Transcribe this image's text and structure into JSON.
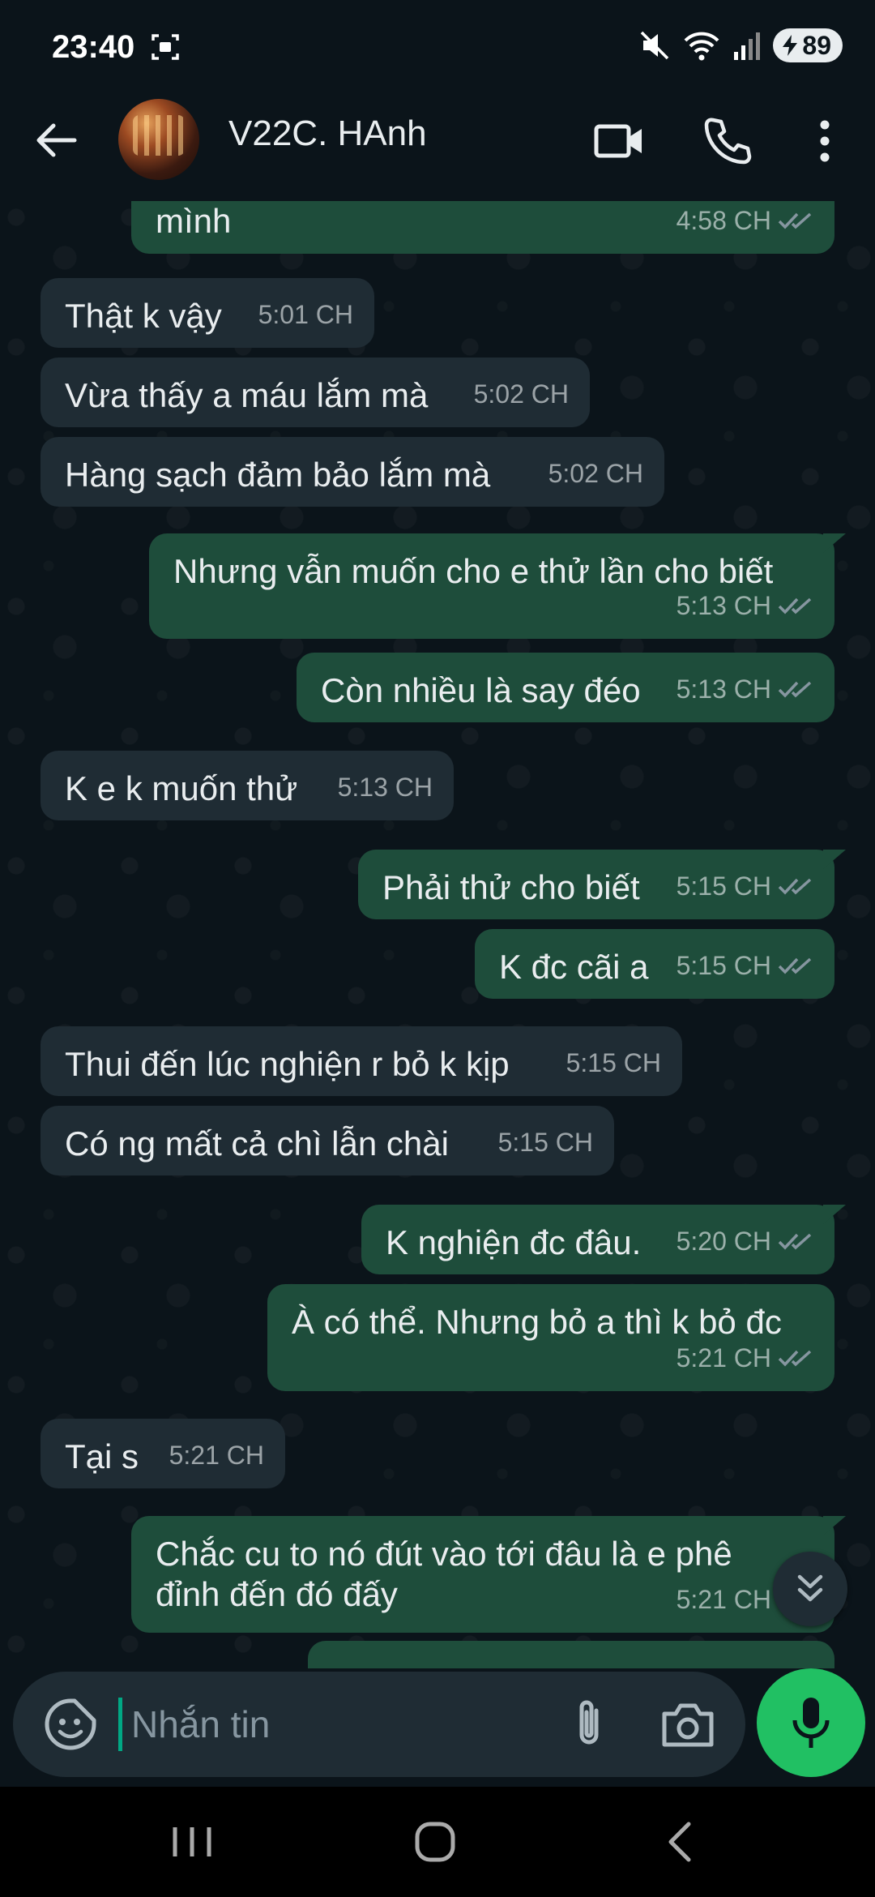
{
  "status_bar": {
    "time": "23:40",
    "battery": "89"
  },
  "header": {
    "contact_name": "V22C. HAnh"
  },
  "messages": [
    {
      "dir": "out",
      "text": "mình",
      "time": "4:58 CH",
      "read": true
    },
    {
      "dir": "in",
      "text": "Thật k vậy",
      "time": "5:01 CH"
    },
    {
      "dir": "in",
      "text": "Vừa thấy a máu lắm mà",
      "time": "5:02 CH"
    },
    {
      "dir": "in",
      "text": "Hàng sạch đảm bảo lắm mà",
      "time": "5:02 CH"
    },
    {
      "dir": "out",
      "text": "Nhưng vẫn muốn cho e thử lần cho biết",
      "time": "5:13 CH",
      "read": true
    },
    {
      "dir": "out",
      "text": "Còn nhiều là say đéo",
      "time": "5:13 CH",
      "read": true
    },
    {
      "dir": "in",
      "text": "K e k muốn thử",
      "time": "5:13 CH"
    },
    {
      "dir": "out",
      "text": "Phải thử cho biết",
      "time": "5:15 CH",
      "read": true
    },
    {
      "dir": "out",
      "text": "K đc cãi a",
      "time": "5:15 CH",
      "read": true
    },
    {
      "dir": "in",
      "text": "Thui đến lúc nghiện r bỏ k kịp",
      "time": "5:15 CH"
    },
    {
      "dir": "in",
      "text": "Có ng mất cả chì lẫn chài",
      "time": "5:15 CH"
    },
    {
      "dir": "out",
      "text": "K nghiện đc đâu.",
      "time": "5:20 CH",
      "read": true
    },
    {
      "dir": "out",
      "text": "À có thể. Nhưng bỏ a thì k bỏ đc",
      "time": "5:21 CH",
      "read": true
    },
    {
      "dir": "in",
      "text": "Tại s",
      "time": "5:21 CH"
    },
    {
      "dir": "out",
      "text": "Chắc cu to nó đút vào tới đâu là e phê đỉnh đến đó đấy",
      "time": "5:21 CH",
      "read": true
    }
  ],
  "input": {
    "placeholder": "Nhắn tin"
  },
  "colors": {
    "outgoing": "#1e4d3b",
    "incoming": "#1f2c34",
    "accent": "#21c063",
    "background": "#0b141a"
  }
}
